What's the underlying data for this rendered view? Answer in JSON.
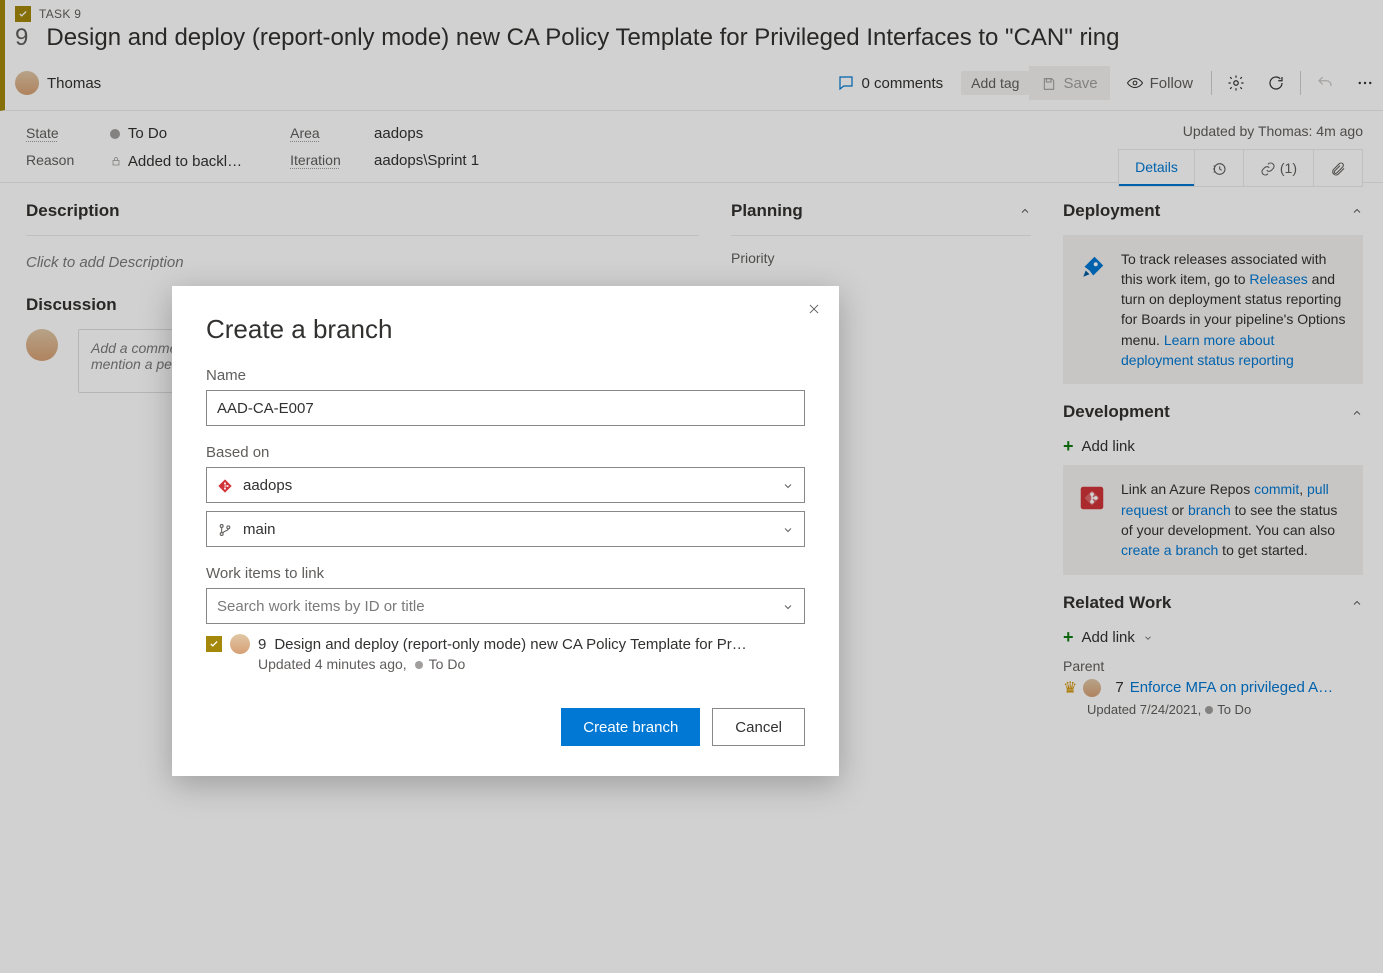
{
  "header": {
    "task_badge_label": "TASK 9",
    "work_item_id": "9",
    "title": "Design and deploy (report-only mode) new CA Policy Template for Privileged Interfaces to \"CAN\" ring",
    "assignee": "Thomas",
    "comments_label": "0 comments",
    "add_tag_label": "Add tag",
    "save_label": "Save",
    "follow_label": "Follow"
  },
  "fields": {
    "state_label": "State",
    "state_value": "To Do",
    "reason_label": "Reason",
    "reason_value": "Added to backl…",
    "area_label": "Area",
    "area_value": "aadops",
    "iteration_label": "Iteration",
    "iteration_value": "aadops\\Sprint 1",
    "updated_by": "Updated by Thomas: 4m ago"
  },
  "tabs": {
    "details": "Details",
    "links_count": "(1)"
  },
  "main": {
    "description_heading": "Description",
    "description_placeholder": "Click to add Description",
    "discussion_heading": "Discussion",
    "discussion_placeholder_1": "Add a comme",
    "discussion_placeholder_2": "mention a pe",
    "planning_heading": "Planning",
    "priority_label": "Priority"
  },
  "side": {
    "deployment_heading": "Deployment",
    "deployment_text_1": "To track releases associated with this work item, go to ",
    "deployment_link_1": "Releases",
    "deployment_text_2": " and turn on deployment status reporting for Boards in your pipeline's Options menu. ",
    "deployment_link_2": "Learn more about deployment status reporting",
    "development_heading": "Development",
    "add_link_label": "Add link",
    "development_text_1": "Link an Azure Repos ",
    "dev_link_commit": "commit",
    "dev_sep_comma": ", ",
    "dev_link_pr": "pull request",
    "dev_text_or": " or ",
    "dev_link_branch": "branch",
    "development_text_2": " to see the status of your development. You can also ",
    "dev_link_create": "create a branch",
    "development_text_3": " to get started.",
    "related_heading": "Related Work",
    "parent_label": "Parent",
    "parent_id": "7",
    "parent_title": "Enforce MFA on privileged Azur…",
    "parent_meta_date": "Updated 7/24/2021,",
    "parent_meta_state": "To Do"
  },
  "dialog": {
    "title": "Create a branch",
    "name_label": "Name",
    "name_value": "AAD-CA-E007",
    "based_on_label": "Based on",
    "repo_value": "aadops",
    "branch_value": "main",
    "work_items_label": "Work items to link",
    "search_placeholder": "Search work items by ID or title",
    "linked_id": "9",
    "linked_title": "Design and deploy (report-only mode) new CA Policy Template for Pr…",
    "linked_meta_updated": "Updated 4 minutes ago,",
    "linked_meta_state": "To Do",
    "create_label": "Create branch",
    "cancel_label": "Cancel"
  }
}
